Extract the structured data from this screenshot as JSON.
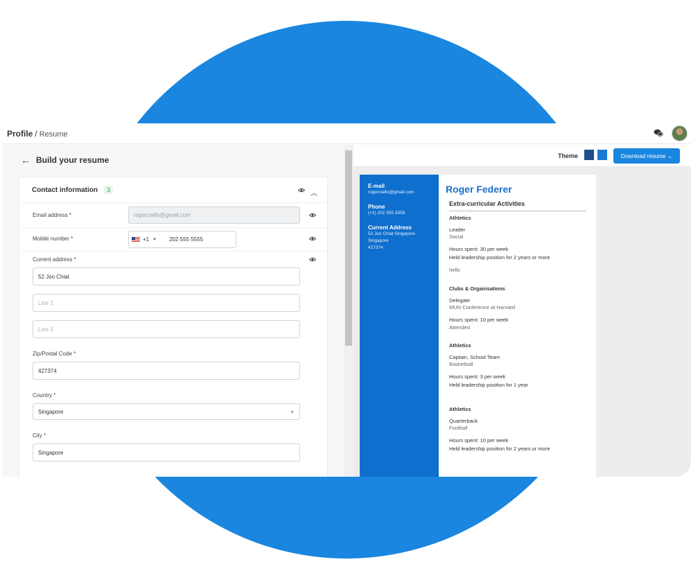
{
  "breadcrumb": {
    "profile": "Profile",
    "separator": "/",
    "resume": "Resume"
  },
  "header_icons": {
    "chat": "chat-icon",
    "avatar": "user-avatar"
  },
  "form": {
    "back_title": "Build your resume",
    "section_title": "Contact information",
    "section_count": "3",
    "email": {
      "label": "Email address",
      "required": "*",
      "value": "rogercialfo@gmail.com"
    },
    "mobile": {
      "label": "Mobile number",
      "required": "*",
      "country_code": "+1",
      "value": "202 555 5555"
    },
    "address": {
      "label": "Current address",
      "required": "*",
      "line1": "52 Joo Chiat",
      "line2_placeholder": "Line 2",
      "line3_placeholder": "Line 3"
    },
    "zip": {
      "label": "Zip/Postal Code",
      "required": "*",
      "value": "427374"
    },
    "country": {
      "label": "Country",
      "required": "*",
      "value": "Singapore"
    },
    "city": {
      "label": "City",
      "required": "*",
      "value": "Singapore"
    }
  },
  "preview": {
    "theme_label": "Theme",
    "theme_colors": [
      "#1f4e8c",
      "#1a78d6"
    ],
    "download_label": "Download resume",
    "accent_color": "#1a86df"
  },
  "resume": {
    "sidebar": {
      "email_label": "E-mail",
      "email_value": "rogercialfo@gmail.com",
      "phone_label": "Phone",
      "phone_value": "(+1) 202 555 5555",
      "address_label": "Current Address",
      "address_line1": "52 Joo Chiat Singapore",
      "address_line2": "Singapore",
      "address_line3": "427374"
    },
    "name": "Roger Federer",
    "section": "Extra-curricular Activities",
    "entries": {
      "e1_title": "Athletics",
      "e1_role": "Leader",
      "e1_sub": "Social",
      "e1_hours": "Hours spent: 30 per week",
      "e1_lead": "Held leadership position for 2 years or more",
      "e1_note": "hello",
      "e2_title": "Clubs & Organisations",
      "e2_role": "Delegate",
      "e2_sub": "MUN Conference at Harvard",
      "e2_hours": "Hours spent: 10 per week",
      "e2_note": "Attended",
      "e3_title": "Athletics",
      "e3_role": "Captain, School Team",
      "e3_sub": "Basketball",
      "e3_hours": "Hours spent: 3 per week",
      "e3_lead": "Held leadership position for 1 year",
      "e4_title": "Athletics",
      "e4_role": "Quarterback",
      "e4_sub": "Football",
      "e4_hours": "Hours spent: 10 per week",
      "e4_lead": "Held leadership position for 2 years or more"
    }
  }
}
